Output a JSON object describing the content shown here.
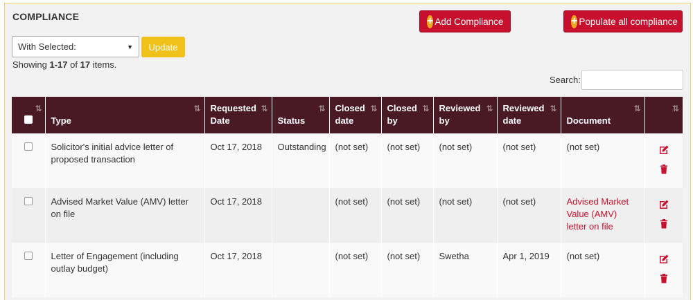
{
  "header": {
    "title": "COMPLIANCE",
    "add_label": "Add Compliance",
    "populate_label": "Populate all compliance"
  },
  "bulk": {
    "select_value": "With Selected:",
    "update_label": "Update"
  },
  "summary": {
    "prefix": "Showing ",
    "range": "1-17",
    "of": " of ",
    "total": "17",
    "suffix": " items."
  },
  "search": {
    "label": "Search:",
    "value": ""
  },
  "table": {
    "columns": {
      "type": "Type",
      "requested_date": "Requested Date",
      "status": "Status",
      "closed_date": "Closed date",
      "closed_by": "Closed by",
      "reviewed_by": "Reviewed by",
      "reviewed_date": "Reviewed date",
      "document": "Document"
    },
    "rows": [
      {
        "type": "Solicitor's initial advice letter of proposed transaction",
        "requested_date": "Oct 17, 2018",
        "status": "Outstanding",
        "closed_date": "(not set)",
        "closed_by": "(not set)",
        "reviewed_by": "(not set)",
        "reviewed_date": "(not set)",
        "document": "(not set)"
      },
      {
        "type": "Advised Market Value (AMV) letter on file",
        "requested_date": "Oct 17, 2018",
        "status": "",
        "closed_date": "(not set)",
        "closed_by": "(not set)",
        "reviewed_by": "(not set)",
        "reviewed_date": "(not set)",
        "document": "Advised Market Value (AMV) letter on file"
      },
      {
        "type": "Letter of Engagement (including outlay budget)",
        "requested_date": "Oct 17, 2018",
        "status": "",
        "closed_date": "(not set)",
        "closed_by": "(not set)",
        "reviewed_by": "Swetha",
        "reviewed_date": "Apr 1, 2019",
        "document": "(not set)"
      }
    ]
  },
  "icons": {
    "plus": "plus-circle-icon",
    "sort": "sort-icon",
    "edit": "edit-icon",
    "delete": "trash-icon",
    "caret": "caret-down-icon"
  },
  "colors": {
    "accent_red": "#c8102e",
    "accent_yellow": "#f0c119",
    "plus_orange": "#f0a71d",
    "header_bg": "#4a1a24",
    "panel_border": "#eed46a"
  }
}
